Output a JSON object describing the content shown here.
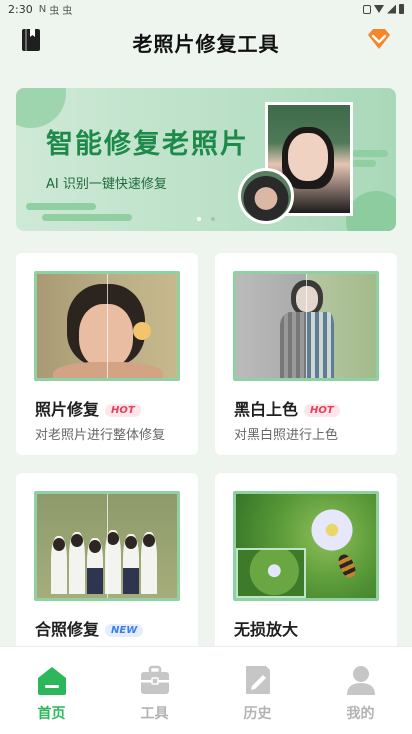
{
  "status_bar": {
    "time": "2:30",
    "notifications": [
      "N",
      "虫",
      "虫"
    ]
  },
  "header": {
    "title": "老照片修复工具",
    "left_icon": "book-icon",
    "right_icon": "vip-diamond-icon",
    "accent": "#f5862a"
  },
  "banner": {
    "headline": "智能修复老照片",
    "subtitle": "AI 识别一键快速修复",
    "slide_count": 2,
    "active_slide": 1
  },
  "features": [
    {
      "label": "照片修复",
      "badge": "HOT",
      "description": "对老照片进行整体修复"
    },
    {
      "label": "黑白上色",
      "badge": "HOT",
      "description": "对黑白照进行上色"
    },
    {
      "label": "合照修复",
      "badge": "NEW",
      "description": ""
    },
    {
      "label": "无损放大",
      "badge": "",
      "description": ""
    }
  ],
  "bottom_nav": [
    {
      "label": "首页",
      "icon": "home-icon",
      "active": true
    },
    {
      "label": "工具",
      "icon": "toolbox-icon",
      "active": false
    },
    {
      "label": "历史",
      "icon": "history-note-icon",
      "active": false
    },
    {
      "label": "我的",
      "icon": "profile-icon",
      "active": false
    }
  ],
  "colors": {
    "primary_green": "#2cb85a",
    "hot_badge": "#e6405d",
    "new_badge": "#3d7ee6",
    "background": "#eef4ee"
  }
}
